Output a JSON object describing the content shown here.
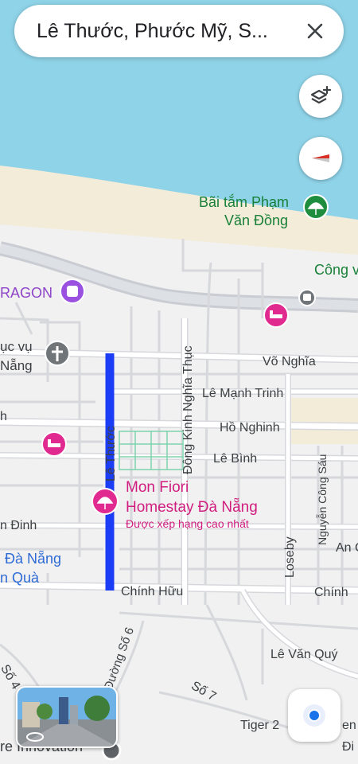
{
  "search": {
    "query": "Lê Thước, Phước Mỹ, S..."
  },
  "colors": {
    "water": "#8fd3e8",
    "sand": "#f3ecd9",
    "land": "#f1f1f1",
    "road": "#ffffff",
    "road_outline": "#d6d8dc",
    "highway": "#c9ccd2",
    "route": "#1a3df5",
    "poi_green": "#1e8e3e",
    "poi_pink": "#e12a8f",
    "poi_purple": "#9b51e0",
    "poi_gray": "#70757a",
    "street_text": "#3c4043",
    "poi_label_pink": "#d11d7f",
    "poi_label_green": "#188038",
    "poi_label_purple": "#8e44c8",
    "poi_label_blue": "#2f6bd6",
    "location_blue": "#1a73e8"
  },
  "map": {
    "streets": {
      "vo_nghia": "Võ Nghĩa",
      "le_manh_trinh": "Lê Mạnh Trinh",
      "ho_nghinh": "Hồ Nghinh",
      "le_binh": "Lê Bình",
      "dong_kinh_nghia_thuc": "Đông Kinh Nghĩa Thục",
      "le_thuoc": "Lê Thước",
      "chinh_huu_1": "Chính Hữu",
      "chinh_huu_2": "Chính",
      "nguyen_cong_sau": "Nguyễn Công Sáu",
      "loseby": "Loseby",
      "le_van_quy": "Lê Văn Quý",
      "duong_so_6": "Đường Số 6",
      "so_7": "Số 7",
      "so_4": "Số 4",
      "tiger": "Tiger 2",
      "an_c": "An C",
      "edge_en": "en",
      "edge_di": "Đi",
      "edge_h": "h",
      "edge_dinh": "n Đinh"
    },
    "pois": {
      "beach_line1": "Bãi tắm Phạm",
      "beach_line2": "Văn Đồng",
      "cong_v": "Công v",
      "dragon": "RAGON",
      "dich_vu_line1": "ục vụ",
      "dich_vu_line2": "Nẵng",
      "homestay_line1": "Mon Fiori",
      "homestay_line2": "Homestay Đà Nẵng",
      "homestay_sub": "Được xếp hạng cao nhất",
      "da_nang_line1": "Đà Nẵng",
      "da_nang_line2": "n Quà",
      "innovation": "re Innovation"
    },
    "icons": {
      "layers": "layers-add-icon",
      "compass": "compass-icon",
      "close": "close-icon",
      "location": "my-location-icon",
      "street_view": "street-view-icon"
    }
  }
}
